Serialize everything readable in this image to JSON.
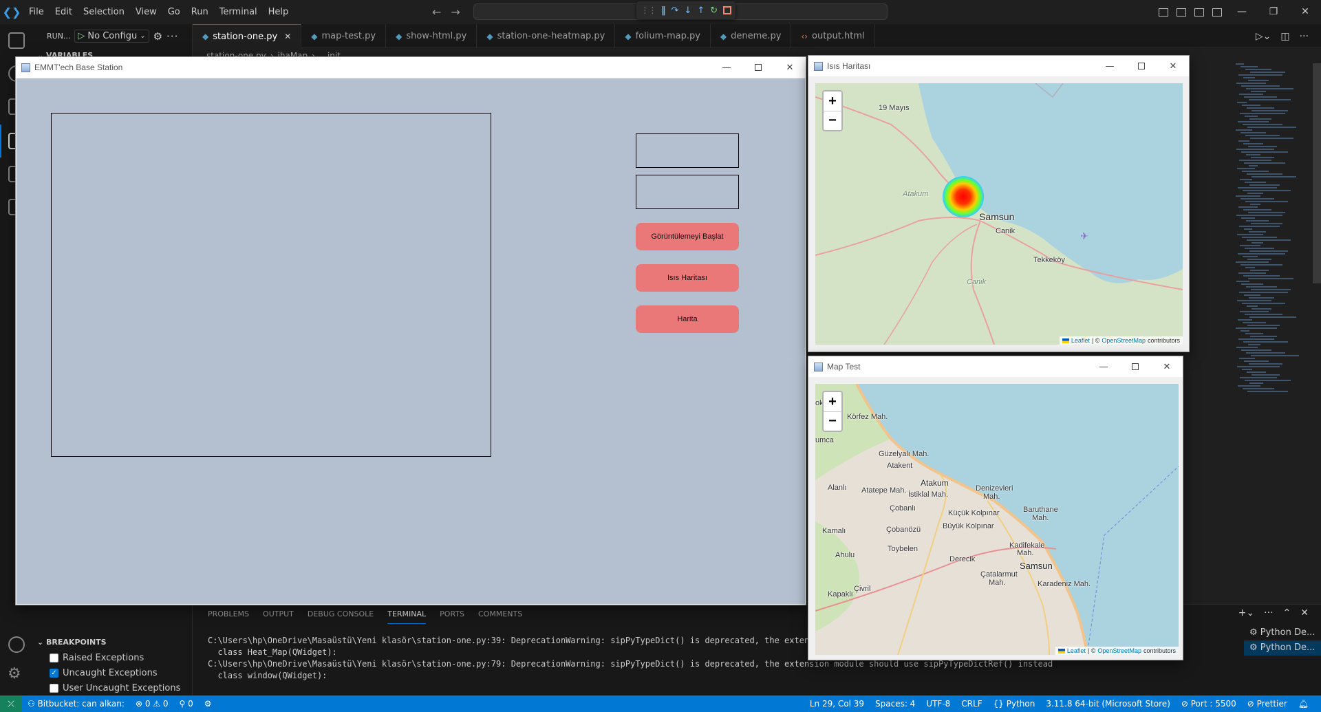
{
  "menu": [
    "File",
    "Edit",
    "Selection",
    "View",
    "Go",
    "Run",
    "Terminal",
    "Help"
  ],
  "run_panel": {
    "title": "RUN...",
    "config": "No Configu",
    "variables_label": "VARIABLES",
    "breakpoints_label": "BREAKPOINTS",
    "breakpoints": [
      {
        "label": "Raised Exceptions",
        "checked": false
      },
      {
        "label": "Uncaught Exceptions",
        "checked": true
      },
      {
        "label": "User Uncaught Exceptions",
        "checked": false
      }
    ]
  },
  "tabs": [
    {
      "label": "station-one.py",
      "type": "py",
      "active": true
    },
    {
      "label": "map-test.py",
      "type": "py",
      "active": false
    },
    {
      "label": "show-html.py",
      "type": "py",
      "active": false
    },
    {
      "label": "station-one-heatmap.py",
      "type": "py",
      "active": false
    },
    {
      "label": "folium-map.py",
      "type": "py",
      "active": false
    },
    {
      "label": "deneme.py",
      "type": "py",
      "active": false
    },
    {
      "label": "output.html",
      "type": "html",
      "active": false
    }
  ],
  "breadcrumbs": [
    "station-one.py",
    "ihaMap",
    "__init__"
  ],
  "panel": {
    "tabs": [
      "PROBLEMS",
      "OUTPUT",
      "DEBUG CONSOLE",
      "TERMINAL",
      "PORTS",
      "COMMENTS"
    ],
    "active_tab": "TERMINAL",
    "terminal_lines": [
      "C:\\Users\\hp\\OneDrive\\Masaüstü\\Yeni klasör\\station-one.py:39: DeprecationWarning: sipPyTypeDict() is deprecated, the extension",
      "  class Heat_Map(QWidget):",
      "C:\\Users\\hp\\OneDrive\\Masaüstü\\Yeni klasör\\station-one.py:79: DeprecationWarning: sipPyTypeDict() is deprecated, the extension module should use sipPyTypeDictRef() instead",
      "  class window(QWidget):"
    ],
    "terminals": [
      "Python De...",
      "Python De..."
    ]
  },
  "statusbar": {
    "bitbucket": "Bitbucket: can alkan:",
    "errors": "0",
    "warnings": "0",
    "ports_count": "0",
    "position": "Ln 29, Col 39",
    "spaces": "Spaces: 4",
    "encoding": "UTF-8",
    "eol": "CRLF",
    "language": "Python",
    "interpreter": "3.11.8 64-bit (Microsoft Store)",
    "port": "Port : 5500",
    "prettier": "Prettier"
  },
  "station_window": {
    "title": "EMMT'ech Base Station",
    "buttons": [
      "Görüntülemeyi Başlat",
      "Isıs Haritası",
      "Harita"
    ]
  },
  "heatmap_window": {
    "title": "Isıs Haritası",
    "labels": {
      "mayis": "19 Mayıs",
      "atakum": "Atakum",
      "samsun": "Samsun",
      "canik": "Canik",
      "tekkekoy": "Tekkeköy",
      "canik2": "Canik"
    }
  },
  "map_window": {
    "title": "Map Test",
    "labels": {
      "korfez": "Körfez Mah.",
      "umca": "umca",
      "okr": "ok",
      "guzelyali": "Güzelyalı Mah.",
      "atakent": "Atakent",
      "atakum": "Atakum",
      "denizevleri": "Denizevleri",
      "denizevleri2": "Mah.",
      "alanli": "Alanlı",
      "atatepe": "Atatepe Mah.",
      "istiklal": "İstiklal Mah.",
      "cobanli": "Çobanlı",
      "kucuk": "Küçük Kolpınar",
      "buyuk": "Büyük Kolpınar",
      "baruthane": "Baruthane",
      "baruthane2": "Mah.",
      "kamali": "Kamalı",
      "cobanozu": "Çobanözü",
      "toybelen": "Toybelen",
      "kadifekale": "Kadifekale",
      "kadifekale2": "Mah.",
      "ahulu": "Ahulu",
      "derecik": "Derecik",
      "samsun": "Samsun",
      "catalarmut": "Çatalarmut",
      "catalarmut2": "Mah.",
      "karadeniz": "Karadeniz Mah.",
      "civril": "Çivril",
      "kapakli": "Kapaklı"
    }
  },
  "map_common": {
    "zoom_in": "+",
    "zoom_out": "−",
    "leaflet": "Leaflet",
    "sep": "| ©",
    "osm": "OpenStreetMap",
    "contributors": "contributors"
  },
  "colors": {
    "accent": "#0078d4",
    "button_bg": "#ea7878",
    "station_bg": "#b4c0cf",
    "sea": "#aad3df"
  }
}
